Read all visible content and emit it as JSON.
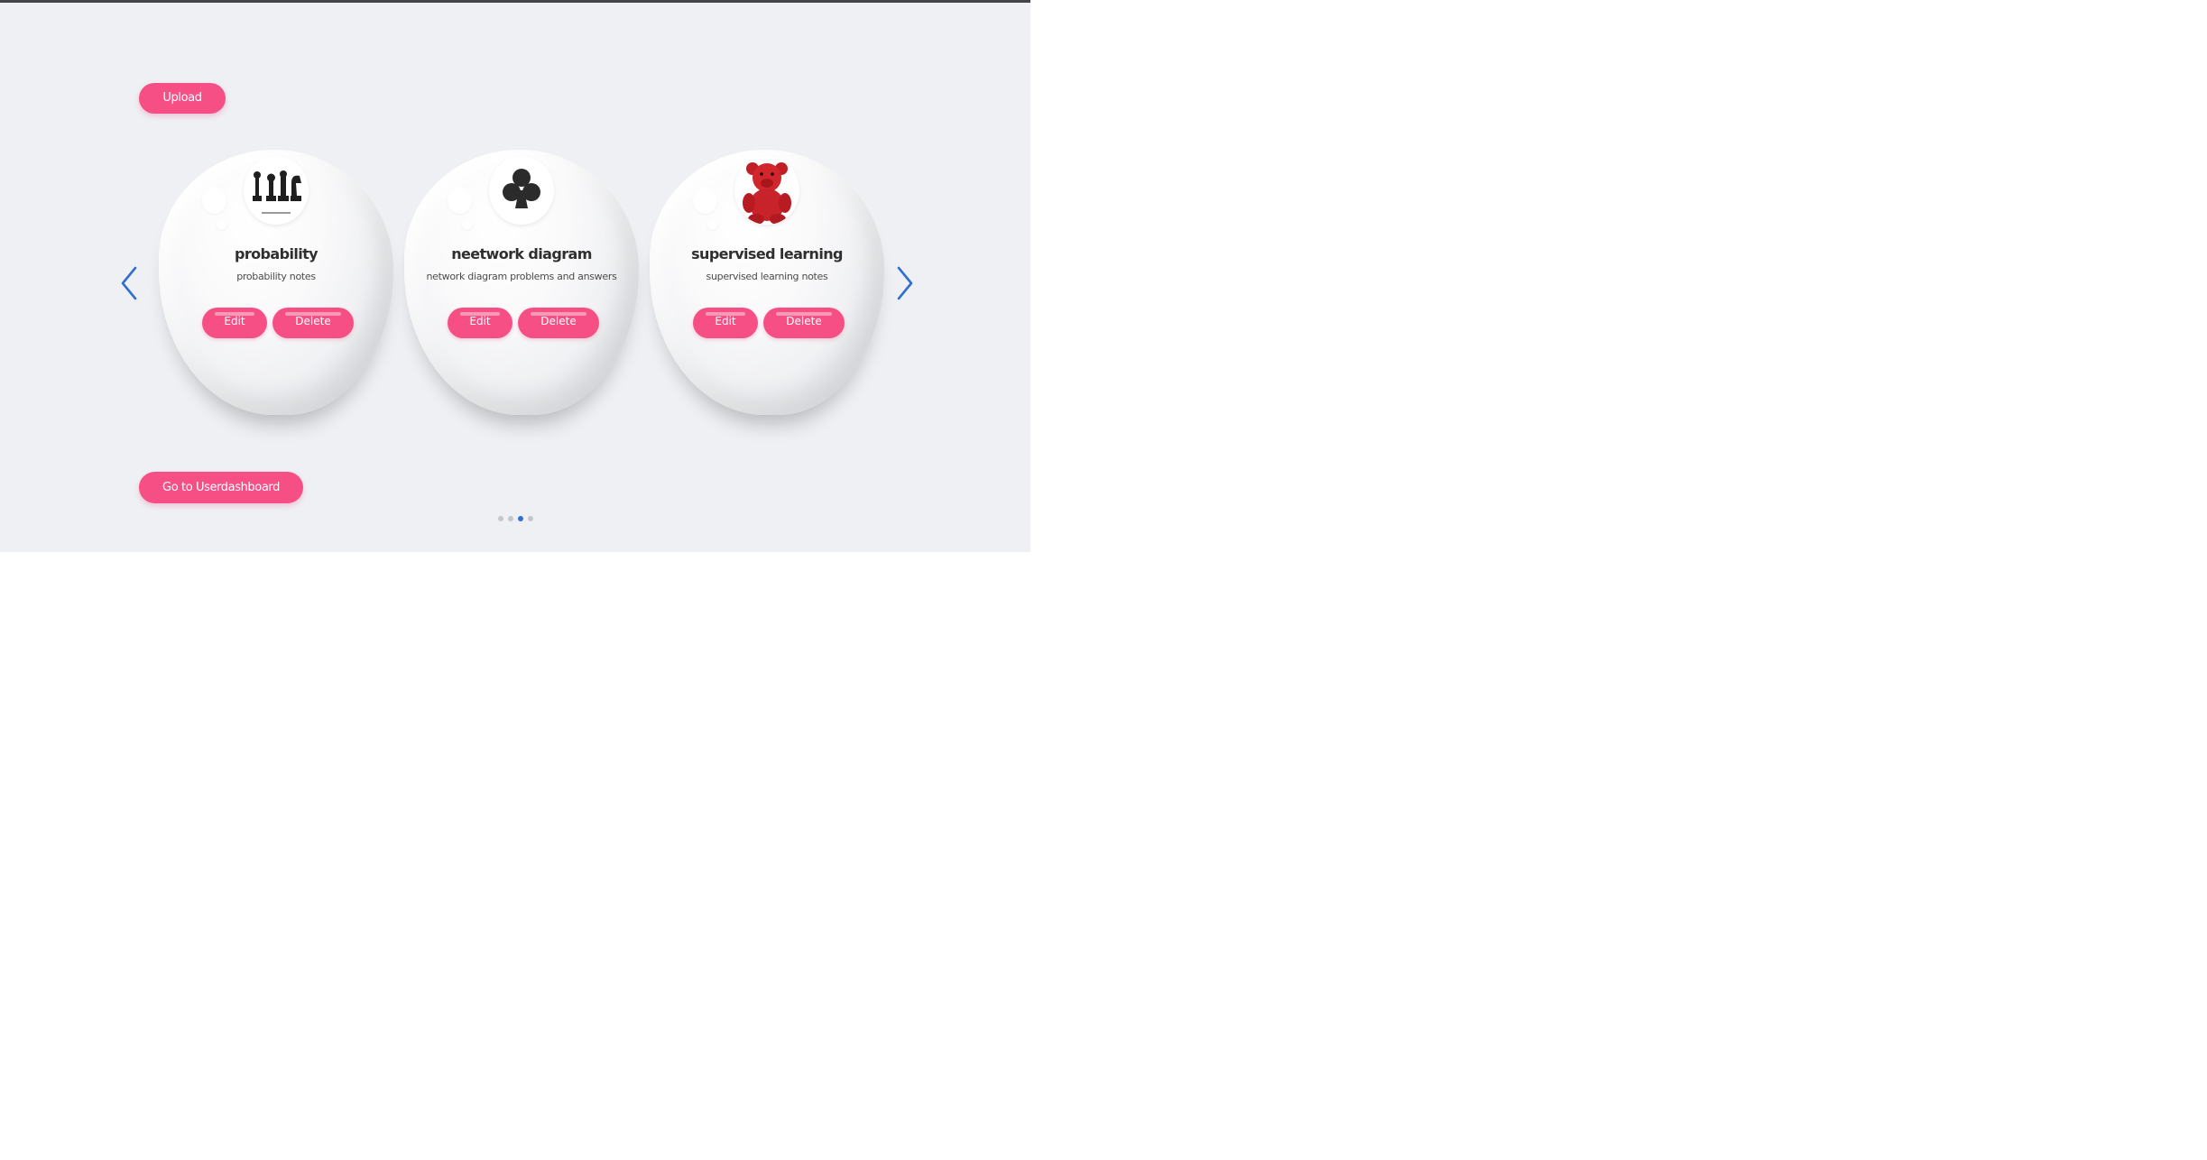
{
  "toolbar": {
    "upload_label": "Upload",
    "dashboard_label": "Go to Userdashboard"
  },
  "carousel": {
    "prev_icon": "chevron-left-icon",
    "next_icon": "chevron-right-icon",
    "accent_color": "#2e6fd0",
    "cards": [
      {
        "title": "probability",
        "description": "probability notes",
        "image": "chess-pieces",
        "edit_label": "Edit",
        "delete_label": "Delete"
      },
      {
        "title": "neetwork diagram",
        "description": "network diagram problems and answers",
        "image": "club-suit",
        "edit_label": "Edit",
        "delete_label": "Delete"
      },
      {
        "title": "supervised learning",
        "description": "supervised learning notes",
        "image": "red-teddy-bear",
        "edit_label": "Edit",
        "delete_label": "Delete"
      }
    ],
    "pagination": {
      "total": 4,
      "active_index": 2
    }
  },
  "colors": {
    "button": "#f64f86",
    "background": "#eef0f4"
  }
}
